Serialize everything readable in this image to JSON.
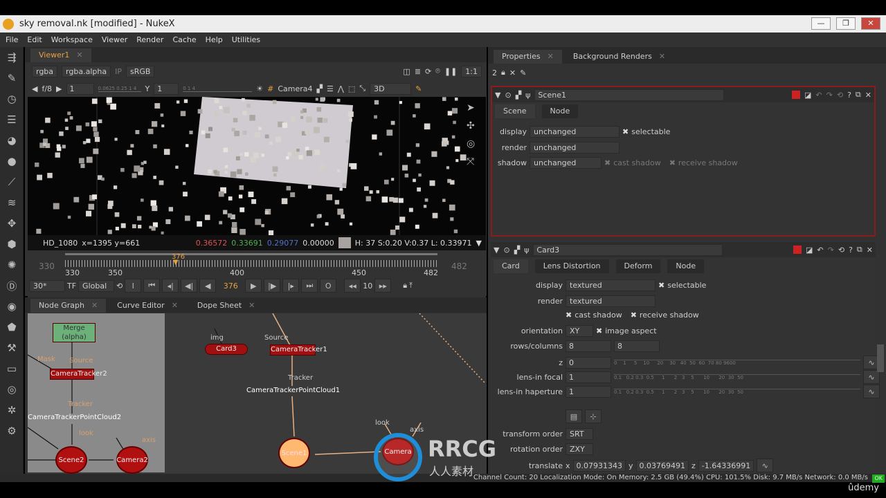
{
  "window": {
    "title": "sky removal.nk [modified] - NukeX",
    "min": "—",
    "max": "❐",
    "close": "✕"
  },
  "menu": [
    "File",
    "Edit",
    "Workspace",
    "Viewer",
    "Render",
    "Cache",
    "Help",
    "Utilities"
  ],
  "viewer": {
    "tab": "Viewer1",
    "channels": "rgba",
    "alpha": "rgba.alpha",
    "ip": "IP",
    "lut": "sRGB",
    "zoom": "1:1",
    "fstop": "f/8",
    "gain": "1",
    "gain_ticks": "0.0625 0.25 1 4",
    "gamma_label": "Y",
    "gamma": "1",
    "gamma_ticks": "0      1      4",
    "camera": "Camera4",
    "mode": "3D",
    "info": {
      "format": "HD_1080",
      "coords": "x=1395 y=661",
      "r": "0.36572",
      "g": "0.33691",
      "b": "0.29077",
      "a": "0.00000",
      "hsvl": "H: 37 S:0.20 V:0.37  L: 0.33971",
      "swatch": "#a8a2a0"
    },
    "timeline": {
      "start": "330",
      "end": "482",
      "ticks": [
        "330",
        "350",
        "400",
        "450",
        "482"
      ],
      "current": "376"
    },
    "controls": {
      "fps": "30*",
      "tf": "TF",
      "global": "Global",
      "frame": "376",
      "step": "10",
      "in": "I",
      "out": "O"
    }
  },
  "nodegraph": {
    "tabs": [
      "Node Graph",
      "Curve Editor",
      "Dope Sheet"
    ],
    "nodes": {
      "merge": "Merge (alpha)",
      "ct2": "CameraTracker2",
      "pc2": "CameraTrackerPointCloud2",
      "scene2": "Scene2",
      "camera2": "Camera2",
      "card3": "Card3",
      "ct1": "CameraTracker1",
      "pc1": "CameraTrackerPointCloud1",
      "scene1": "Scene1",
      "camera": "Camera"
    },
    "labels": {
      "mask": "Mask",
      "source": "Source",
      "tracker": "Tracker",
      "look": "look",
      "axis": "axis",
      "img": "img",
      "source1": "Source",
      "tracker1": "Tracker",
      "look1": "look",
      "axis1": "axis"
    }
  },
  "properties": {
    "tabs": [
      "Properties",
      "Background Renders"
    ],
    "count": "2",
    "scene1": {
      "name": "Scene1",
      "tabs": [
        "Scene",
        "Node"
      ],
      "rows": [
        {
          "label": "display",
          "value": "unchanged",
          "extra": "selectable"
        },
        {
          "label": "render",
          "value": "unchanged"
        },
        {
          "label": "shadow",
          "value": "unchanged",
          "extra1": "cast shadow",
          "extra2": "receive shadow"
        }
      ]
    },
    "card3": {
      "name": "Card3",
      "tabs": [
        "Card",
        "Lens Distortion",
        "Deform",
        "Node"
      ],
      "display": "textured",
      "selectable": "selectable",
      "render": "textured",
      "cast": "cast shadow",
      "receive": "receive shadow",
      "orientation": "XY",
      "image_aspect": "image aspect",
      "rows": "8",
      "columns": "8",
      "z": "0",
      "focal": "1",
      "haperture": "1",
      "z_ticks": "0    1     5    10     20    30   40  50  60  70 80 9600",
      "lens_ticks": "0.1   0.2 0.3  0.5     1      2   3    5      10      20  30  50",
      "transform_order": "SRT",
      "rotation_order": "ZXY",
      "tx": "0.07931343",
      "ty": "0.03769491",
      "tz": "-1.64336991",
      "labels": {
        "display": "display",
        "render": "render",
        "orientation": "orientation",
        "rowscols": "rows/columns",
        "z": "z",
        "focal": "lens-in focal",
        "hap": "lens-in haperture",
        "to": "transform order",
        "ro": "rotation order",
        "translate": "translate",
        "x": "x",
        "y": "y",
        "zz": "z"
      }
    }
  },
  "status": {
    "text": "Channel Count: 20  Localization Mode: On  Memory: 2.5 GB (49.4%)  CPU: 101.5%  Disk: 9.7 MB/s  Network: 0.0 MB/s",
    "ok": "OK"
  },
  "watermark": {
    "brand": "RRCG",
    "sub": "人人素材",
    "udemy": "ûdemy"
  },
  "colors": {
    "accent": "#e8a040",
    "nodeRed": "#a01010",
    "sceneSelected": "#ffb870"
  }
}
